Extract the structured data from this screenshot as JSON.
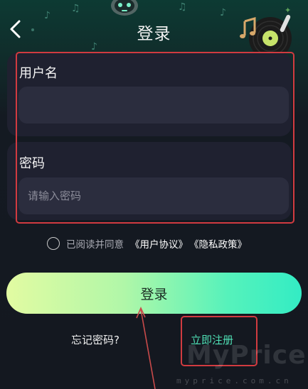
{
  "header": {
    "title": "登录"
  },
  "form": {
    "username_label": "用户名",
    "username_value": "",
    "password_label": "密码",
    "password_placeholder": "请输入密码"
  },
  "agreement": {
    "prefix": "已阅读并同意",
    "user_agreement": "《用户协议》",
    "privacy_policy": "《隐私政策》",
    "checked": false
  },
  "actions": {
    "login_label": "登录",
    "forgot_label": "忘记密码?",
    "register_label": "立即注册"
  },
  "watermark": {
    "brand": "MyPrice",
    "url": "myprice.com.cn"
  },
  "colors": {
    "highlight": "#d13b40",
    "accent_green": "#4fe0b5",
    "button_gradient_start": "#e2fba2",
    "button_gradient_end": "#33ecc4",
    "background": "#141820"
  },
  "icons": [
    "back-icon",
    "robot-icon",
    "vinyl-record-icon",
    "music-note-icon",
    "radio-circle-icon"
  ]
}
